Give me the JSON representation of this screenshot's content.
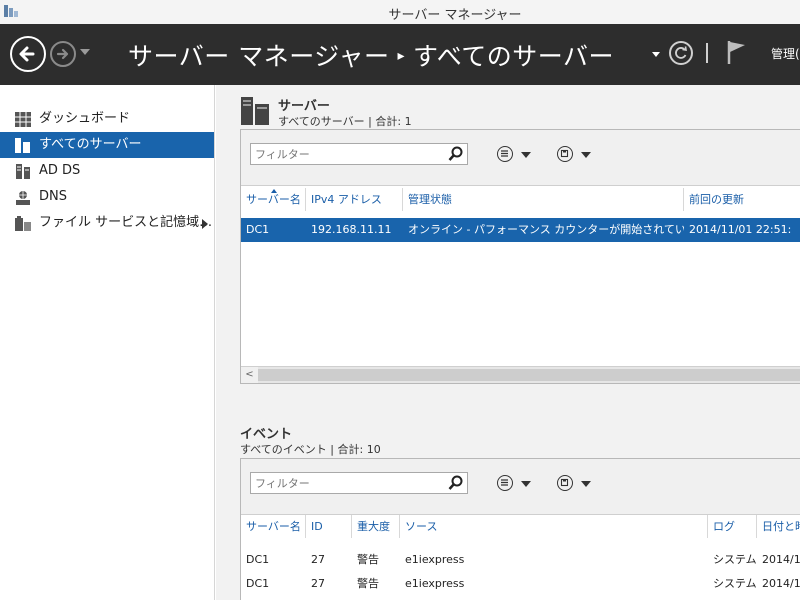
{
  "window": {
    "title": "サーバー マネージャー"
  },
  "header": {
    "breadcrumb_root": "サーバー マネージャー",
    "breadcrumb_sep": "▸",
    "breadcrumb_current": "すべてのサーバー",
    "manage_label": "管理("
  },
  "sidebar": {
    "items": [
      {
        "label": "ダッシュボード",
        "icon": "dashboard-icon"
      },
      {
        "label": "すべてのサーバー",
        "icon": "all-servers-icon",
        "active": true
      },
      {
        "label": "AD DS",
        "icon": "ad-ds-icon"
      },
      {
        "label": "DNS",
        "icon": "dns-icon"
      },
      {
        "label": "ファイル サービスと記憶域…",
        "icon": "file-services-icon",
        "has_submenu": true
      }
    ]
  },
  "servers": {
    "title": "サーバー",
    "subtitle": "すべてのサーバー | 合計: 1",
    "filter_placeholder": "フィルター",
    "columns": [
      "サーバー名",
      "IPv4 アドレス",
      "管理状態",
      "前回の更新"
    ],
    "rows": [
      [
        "DC1",
        "192.168.11.11",
        "オンライン - パフォーマンス カウンターが開始されていません",
        "2014/11/01 22:51:"
      ]
    ],
    "scroll_left": "<"
  },
  "events": {
    "title": "イベント",
    "subtitle": "すべてのイベント | 合計: 10",
    "filter_placeholder": "フィルター",
    "columns": [
      "サーバー名",
      "ID",
      "重大度",
      "ソース",
      "ログ",
      "日付と時"
    ],
    "rows": [
      [
        "DC1",
        "27",
        "警告",
        "e1iexpress",
        "システム",
        "2014/1"
      ],
      [
        "DC1",
        "27",
        "警告",
        "e1iexpress",
        "システム",
        "2014/1"
      ]
    ]
  },
  "colors": {
    "accent": "#1964ac",
    "header_bg": "#2d2d2d",
    "column_header": "#1a5ea8"
  }
}
